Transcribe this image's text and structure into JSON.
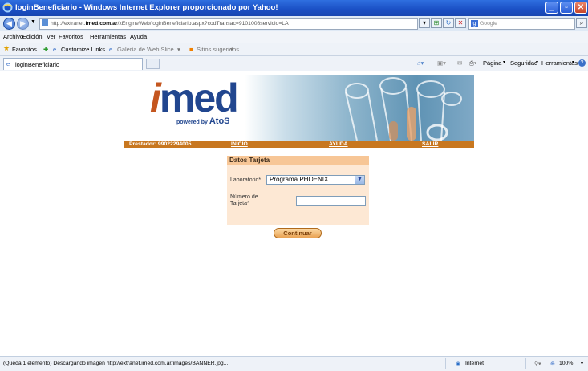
{
  "window": {
    "title": "loginBeneficiario - Windows Internet Explorer proporcionado por Yahoo!"
  },
  "address": {
    "url_prefix": "http://extranet.",
    "url_domain": "imed.com.ar",
    "url_suffix": "/xEngineWeb/loginBeneficiario.aspx?codTransac=9101008servicio=LA",
    "search_placeholder": "Google"
  },
  "menu": {
    "items": [
      "Archivo",
      "Edición",
      "Ver",
      "Favoritos",
      "Herramientas",
      "Ayuda"
    ]
  },
  "favorites": {
    "label": "Favoritos",
    "customize": "Customize Links",
    "gallery": "Galería de Web Slice",
    "suggested": "Sitios sugeridos"
  },
  "tab": {
    "title": "loginBeneficiario"
  },
  "commandbar": {
    "page": "Página",
    "security": "Seguridad",
    "tools": "Herramientas"
  },
  "site": {
    "logo": "imed",
    "powered_by": "powered by",
    "powered_brand": "AtoS",
    "nav": {
      "prestador": "Prestador: 99022294005",
      "inicio": "INICIO",
      "ayuda": "AYUDA",
      "salir": "SALIR"
    }
  },
  "form": {
    "header": "Datos Tarjeta",
    "laboratorio_label": "Laboratorio*",
    "laboratorio_value": "Programa PHOENIX",
    "tarjeta_label_1": "Número de",
    "tarjeta_label_2": "Tarjeta*",
    "tarjeta_value": "",
    "submit": "Continuar"
  },
  "status": {
    "text": "(Queda 1 elemento) Descargando imagen http://extranet.imed.com.ar/images/BANNER.jpg...",
    "zone": "Internet",
    "zoom": "100%"
  },
  "colors": {
    "nav_strip": "#c8771f",
    "panel_bg": "#fde8d4",
    "panel_header": "#f7c696",
    "brand_blue": "#21468f",
    "brand_orange": "#c4561f"
  }
}
